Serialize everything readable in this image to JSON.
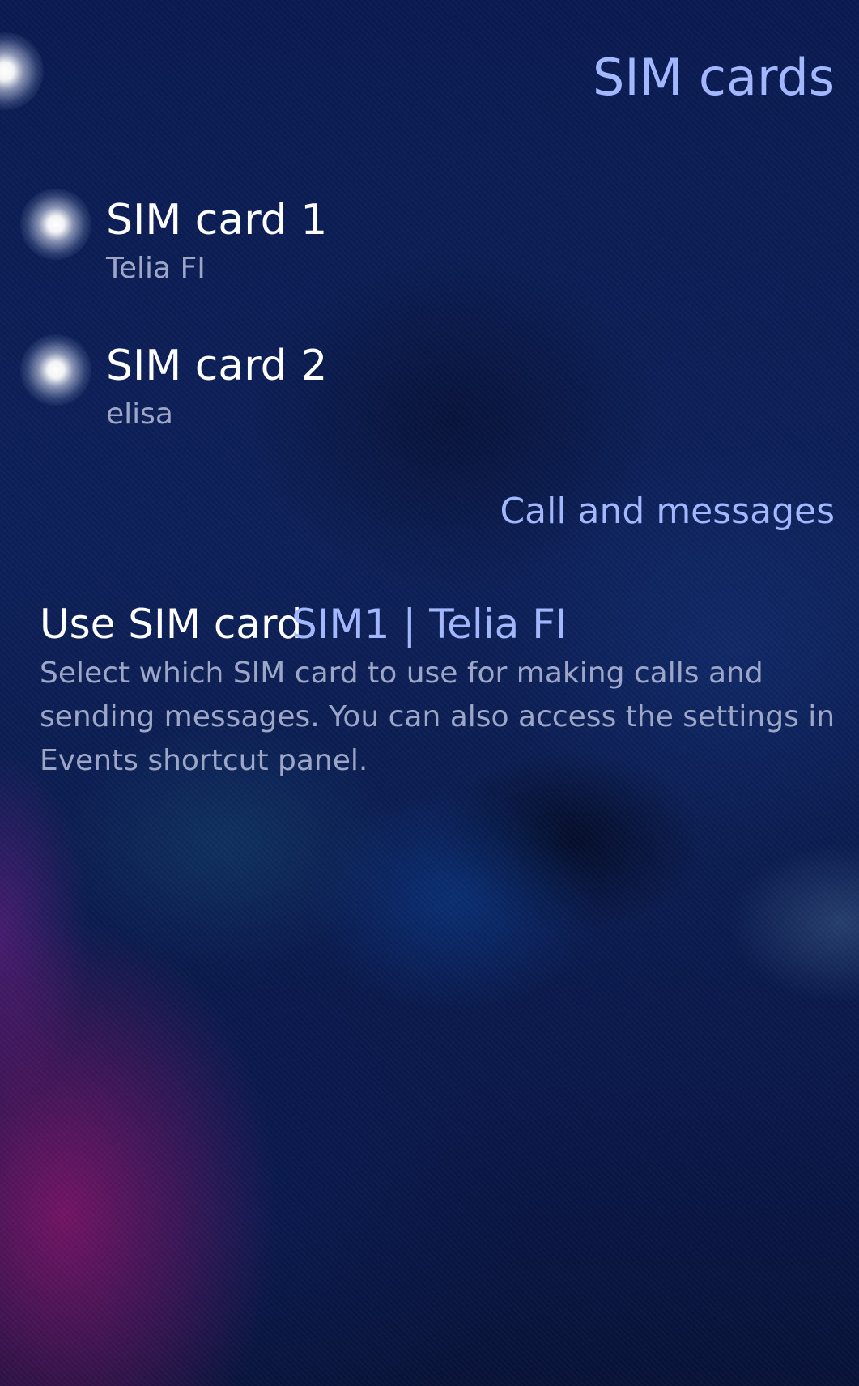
{
  "page": {
    "title": "SIM cards"
  },
  "sim_cards": [
    {
      "name": "SIM card 1",
      "operator": "Telia FI"
    },
    {
      "name": "SIM card 2",
      "operator": "elisa"
    }
  ],
  "section": {
    "header": "Call and messages"
  },
  "sim_selector": {
    "label": "Use SIM card",
    "value": "SIM1 | Telia FI",
    "description": "Select which SIM card to use for making calls and sending messages. You can also access the settings in Events shortcut panel."
  },
  "colors": {
    "background": "#0b1a4a",
    "highlight": "#a3b7ff",
    "primary_text": "#ffffff",
    "secondary_text": "#9ea6c8"
  },
  "icons": {
    "pulley_menu_indicator": "glow-dot-icon",
    "sim_status": "glow-dot-icon"
  }
}
